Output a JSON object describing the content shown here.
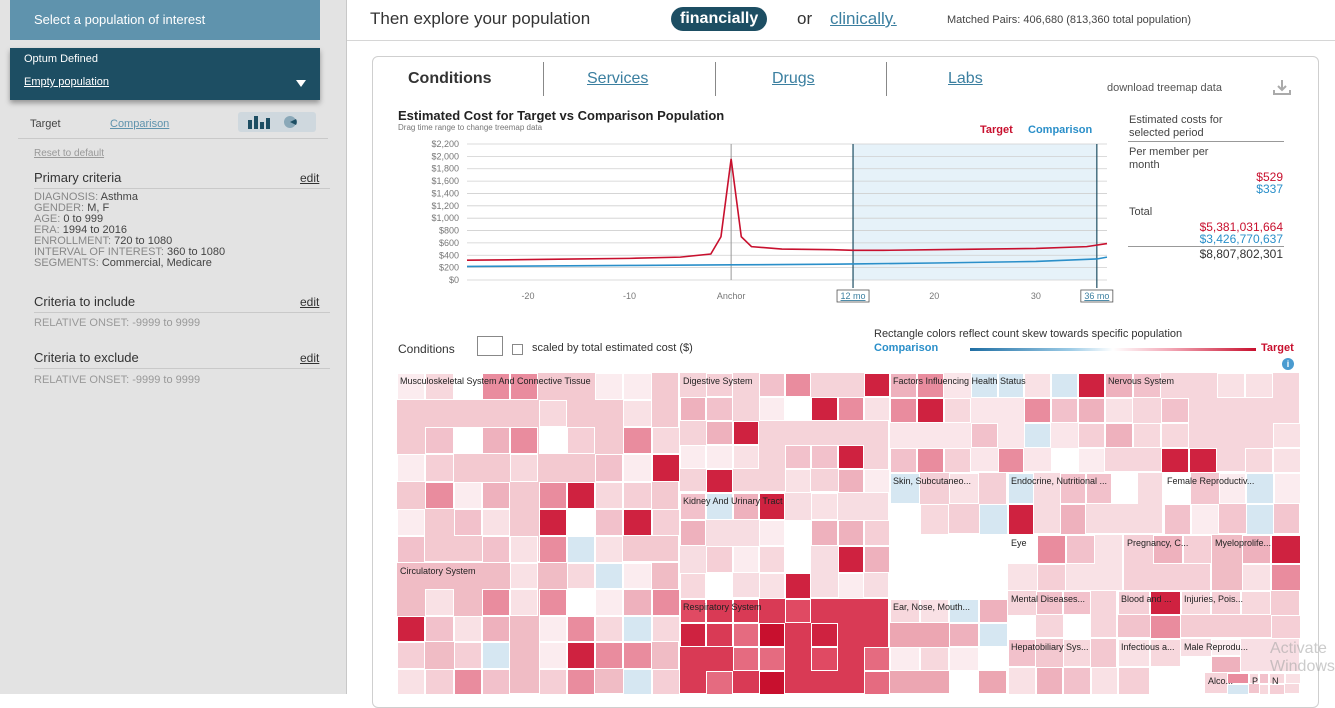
{
  "sidebar": {
    "header": "Select a population of interest",
    "options": [
      "Optum Defined",
      "Empty population"
    ],
    "tabs": {
      "target": "Target",
      "comparison": "Comparison"
    },
    "reset": "Reset to default",
    "primary": {
      "title": "Primary criteria",
      "edit": "edit",
      "items": [
        {
          "k": "DIAGNOSIS:",
          "v": "Asthma"
        },
        {
          "k": "GENDER:",
          "v": "M, F"
        },
        {
          "k": "AGE:",
          "v": "0 to 999"
        },
        {
          "k": "ERA:",
          "v": "1994 to 2016"
        },
        {
          "k": "ENROLLMENT:",
          "v": "720 to 1080"
        },
        {
          "k": "INTERVAL OF INTEREST:",
          "v": "360 to 1080"
        },
        {
          "k": "SEGMENTS:",
          "v": "Commercial, Medicare"
        }
      ]
    },
    "include": {
      "title": "Criteria to include",
      "edit": "edit",
      "line": "RELATIVE ONSET:  -9999 to 9999"
    },
    "exclude": {
      "title": "Criteria to exclude",
      "edit": "edit",
      "line": "RELATIVE ONSET:  -9999 to 9999"
    }
  },
  "header": {
    "lead": "Then explore your population",
    "financially": "financially",
    "or": "or",
    "clinically": "clinically.",
    "matched": "Matched Pairs: 406,680 (813,360 total population)"
  },
  "tabs": {
    "conditions": "Conditions",
    "services": "Services",
    "drugs": "Drugs",
    "labs": "Labs",
    "download": "download treemap data"
  },
  "chart_data": {
    "type": "line",
    "title": "Estimated Cost for Target vs Comparison Population",
    "subtitle": "Drag time range to change treemap data",
    "yticks": [
      "$2,200",
      "$2,000",
      "$1,800",
      "$1,600",
      "$1,400",
      "$1,200",
      "$1,000",
      "$800",
      "$600",
      "$400",
      "$200",
      "$0"
    ],
    "xticks": [
      "-20",
      "-10",
      "Anchor",
      "12 mo",
      "20",
      "30",
      "36 mo"
    ],
    "xlim": [
      -26,
      37
    ],
    "ylim": [
      0,
      2200
    ],
    "selection": [
      12,
      36
    ],
    "series": [
      {
        "name": "Target",
        "color": "#c8102e",
        "x": [
          -26,
          -20,
          -15,
          -10,
          -5,
          -2,
          -1,
          0,
          1,
          2,
          5,
          10,
          12,
          15,
          20,
          25,
          30,
          35,
          37
        ],
        "y": [
          320,
          330,
          340,
          350,
          370,
          420,
          700,
          1960,
          700,
          540,
          500,
          490,
          480,
          480,
          490,
          500,
          510,
          540,
          590
        ]
      },
      {
        "name": "Comparison",
        "color": "#2a8fc9",
        "x": [
          -26,
          -20,
          -10,
          0,
          10,
          12,
          20,
          30,
          36,
          37
        ],
        "y": [
          220,
          225,
          235,
          245,
          255,
          260,
          275,
          300,
          340,
          370
        ]
      }
    ]
  },
  "estimates": {
    "title": "Estimated costs for selected period",
    "pmpm_label": "Per member per month",
    "pmpm_target": "$529",
    "pmpm_comp": "$337",
    "total_label": "Total",
    "total_target": "$5,381,031,664",
    "total_comp": "$3,426,770,637",
    "total_sum": "$8,807,802,301"
  },
  "treemap_controls": {
    "label": "Conditions",
    "scaled": "scaled by total estimated cost ($)",
    "note": "Rectangle colors reflect count skew towards specific population",
    "comparison": "Comparison",
    "target": "Target",
    "info": "i"
  },
  "treemap": {
    "groups": [
      {
        "label": "Musculoskeletal System And Connective Tissue",
        "color": "#f3c9d0"
      },
      {
        "label": "Circulatory System",
        "color": "#f0bcc5"
      },
      {
        "label": "Digestive System",
        "color": "#f5d3d9"
      },
      {
        "label": "Kidney And Urinary Tract",
        "color": "#f7dde2"
      },
      {
        "label": "Respiratory System",
        "color": "#d93a55"
      },
      {
        "label": "Factors Influencing Health Status",
        "color": "#fae6ea"
      },
      {
        "label": "Nervous System",
        "color": "#f6d6dc"
      },
      {
        "label": "Skin, Subcutaneo...",
        "color": "#f4cfd6"
      },
      {
        "label": "Endocrine, Nutritional ...",
        "color": "#f7dbe0"
      },
      {
        "label": "Female Reproductiv...",
        "color": "#f3c6cf"
      },
      {
        "label": "Eye",
        "color": "#f9e2e6"
      },
      {
        "label": "Pregnancy, C...",
        "color": "#f5d0d7"
      },
      {
        "label": "Myeloprolife...",
        "color": "#f0bcc5"
      },
      {
        "label": "Ear, Nose, Mouth...",
        "color": "#eca6b2"
      },
      {
        "label": "Mental Diseases...",
        "color": "#f6d5db"
      },
      {
        "label": "Blood and ...",
        "color": "#f2c3cc"
      },
      {
        "label": "Injuries, Pois...",
        "color": "#f4ccd3"
      },
      {
        "label": "Male Reprodu...",
        "color": "#f8dfe4"
      },
      {
        "label": "Hepatobiliary Sys...",
        "color": "#f3c8d0"
      },
      {
        "label": "Infectious a...",
        "color": "#f5d2d8"
      },
      {
        "label": "Alco...",
        "color": "#f6d4da"
      },
      {
        "label": "P",
        "color": "#f2c5cd"
      },
      {
        "label": "N",
        "color": "#f7d9de"
      }
    ]
  },
  "watermark": "Activate Windows"
}
